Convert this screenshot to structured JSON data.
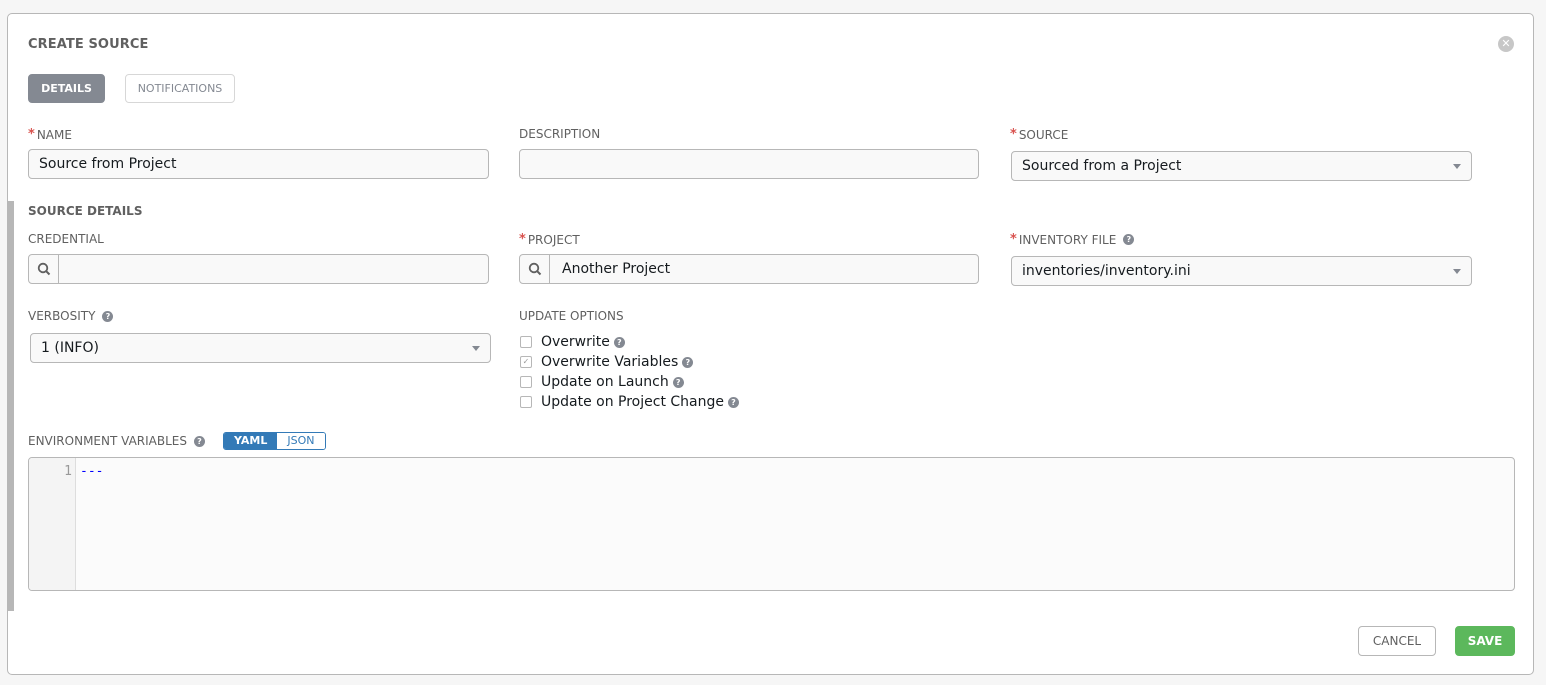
{
  "header": {
    "title": "CREATE SOURCE",
    "close_icon": "close-circle-icon"
  },
  "tabs": [
    {
      "label": "DETAILS",
      "active": true
    },
    {
      "label": "NOTIFICATIONS",
      "active": false
    }
  ],
  "fields": {
    "name": {
      "label": "NAME",
      "required": true,
      "value": "Source from Project"
    },
    "description": {
      "label": "DESCRIPTION",
      "required": false,
      "value": ""
    },
    "source": {
      "label": "SOURCE",
      "required": true,
      "value": "Sourced from a Project"
    }
  },
  "source_details": {
    "heading": "SOURCE DETAILS",
    "credential": {
      "label": "CREDENTIAL",
      "value": ""
    },
    "project": {
      "label": "PROJECT",
      "required": true,
      "value": "Another Project"
    },
    "inventory_file": {
      "label": "INVENTORY FILE",
      "required": true,
      "value": "inventories/inventory.ini"
    },
    "verbosity": {
      "label": "VERBOSITY",
      "value": "1 (INFO)"
    },
    "update_options": {
      "label": "UPDATE OPTIONS",
      "options": [
        {
          "label": "Overwrite",
          "checked": false
        },
        {
          "label": "Overwrite Variables",
          "checked": true
        },
        {
          "label": "Update on Launch",
          "checked": false
        },
        {
          "label": "Update on Project Change",
          "checked": false
        }
      ]
    },
    "environment_variables": {
      "label": "ENVIRONMENT VARIABLES",
      "modes": [
        "YAML",
        "JSON"
      ],
      "active_mode": "YAML",
      "lines": [
        {
          "number": "1",
          "text": "---"
        }
      ]
    }
  },
  "actions": {
    "cancel_label": "CANCEL",
    "save_label": "SAVE"
  },
  "colors": {
    "required": "#d9534f",
    "active_tab": "#848992",
    "toggle_active": "#337ab7",
    "save": "#5cb85c"
  }
}
